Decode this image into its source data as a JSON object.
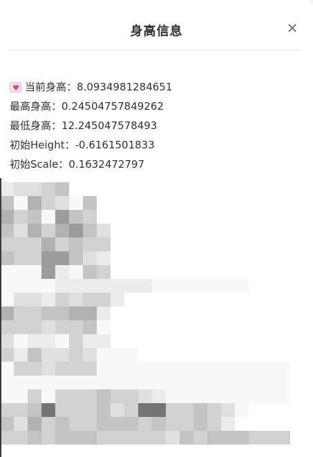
{
  "dialog": {
    "title": "身高信息",
    "close_symbol": "×"
  },
  "info": {
    "current_label": "当前身高：",
    "current_value": "8.0934981284651",
    "max_label": "最高身高：",
    "max_value": "0.24504757849262",
    "min_label": "最低身高：",
    "min_value": "12.245047578493",
    "init_height_label": "初始Height：",
    "init_height_value": "-0.6161501833",
    "init_scale_label": "初始Scale：",
    "init_scale_value": "0.1632472797"
  },
  "icons": {
    "current_row": "heart-icon",
    "close": "close-icon"
  },
  "image": {
    "content": "pixelated-placeholder"
  }
}
